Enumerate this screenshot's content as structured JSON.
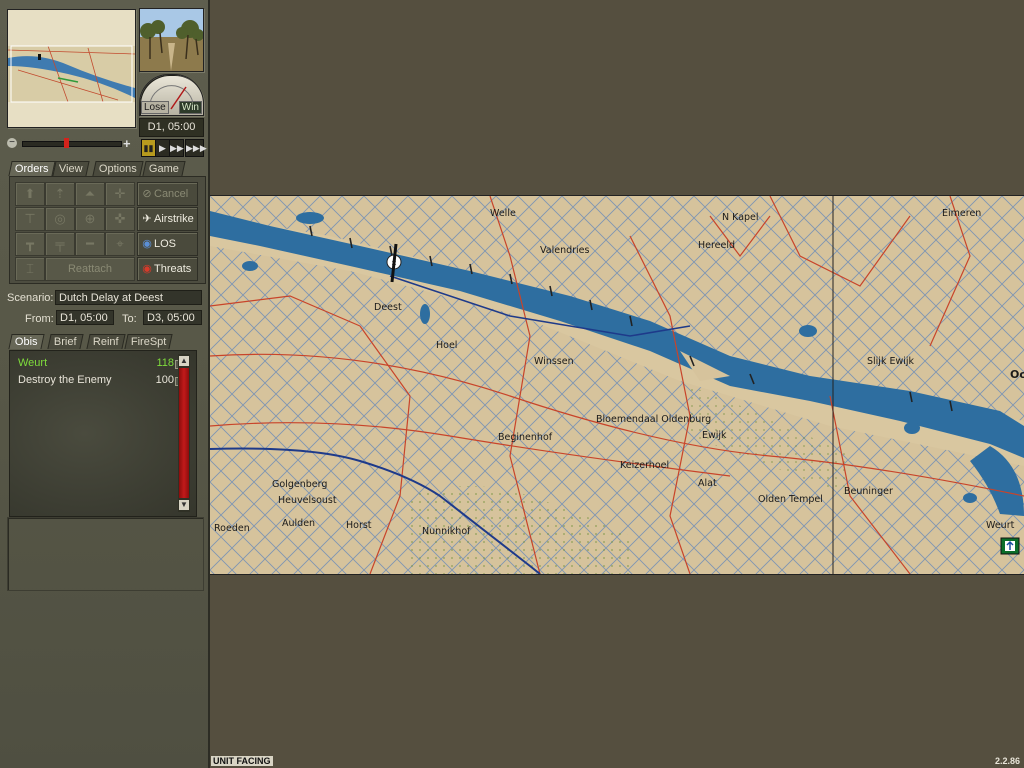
{
  "sidebar": {
    "gauge": {
      "lose_label": "Lose",
      "win_label": "Win"
    },
    "clock": "D1, 05:00",
    "speed_buttons": [
      "▮▮",
      "▶",
      "▶▶",
      "▶▶▶"
    ],
    "tabs": [
      "Orders",
      "View",
      "Options",
      "Game"
    ],
    "active_tab": "Orders",
    "commands": {
      "cancel": "Cancel",
      "airstrike": "Airstrike",
      "los": "LOS",
      "threats": "Threats",
      "reattach": "Reattach"
    },
    "scenario": {
      "label": "Scenario:",
      "value": "Dutch Delay at Deest",
      "from_label": "From:",
      "from_value": "D1, 05:00",
      "to_label": "To:",
      "to_value": "D3, 05:00"
    },
    "info_tabs": [
      "Obis",
      "Brief",
      "Reinf",
      "FireSpt"
    ],
    "objectives": [
      {
        "name": "Weurt",
        "value": "118",
        "color": "#7fdc3c"
      },
      {
        "name": "Destroy the Enemy",
        "value": "100",
        "color": "#e8e4d8"
      }
    ]
  },
  "map": {
    "places": [
      {
        "name": "Welle"
      },
      {
        "name": "N Kapel"
      },
      {
        "name": "Eimeren"
      },
      {
        "name": "Valendries"
      },
      {
        "name": "Hereeld"
      },
      {
        "name": "Deest"
      },
      {
        "name": "Hoel"
      },
      {
        "name": "Winssen"
      },
      {
        "name": "Slijk Ewijk"
      },
      {
        "name": "Oo"
      },
      {
        "name": "Bloemendaal Oldenburg"
      },
      {
        "name": "Ewijk"
      },
      {
        "name": "Beginenhof"
      },
      {
        "name": "Keizerhoel"
      },
      {
        "name": "Alat"
      },
      {
        "name": "Olden Tempel"
      },
      {
        "name": "Beuninger"
      },
      {
        "name": "Weurt"
      },
      {
        "name": "Golgenberg"
      },
      {
        "name": "Heuvelsoust"
      },
      {
        "name": "Aulden"
      },
      {
        "name": "Horst"
      },
      {
        "name": "Nunnikhof"
      },
      {
        "name": "Roeden"
      }
    ],
    "colors": {
      "land": "#d6c39c",
      "water": "#2e6ea0",
      "road": "#c8442a",
      "rail": "#1e3a8a",
      "hatch": "#7e95b4"
    }
  },
  "status": {
    "left": "UNIT FACING",
    "version": "2.2.86"
  }
}
